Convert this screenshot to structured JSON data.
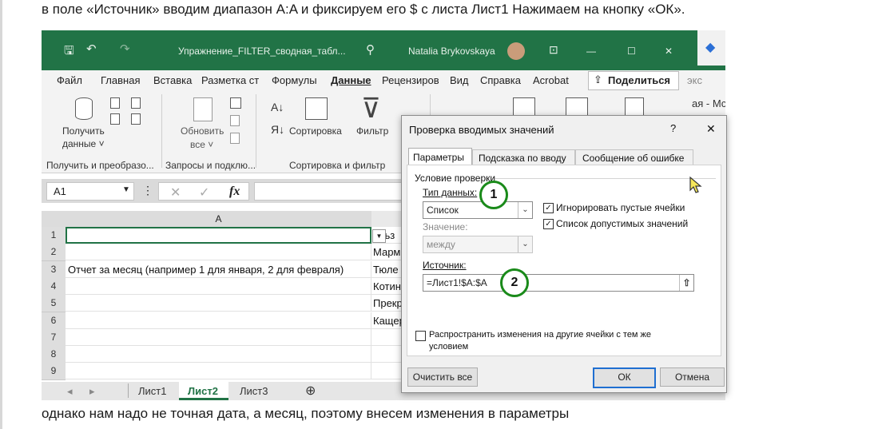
{
  "doc": {
    "top_text": "в поле «Источник» вводим диапазон A:A и фиксируем его $ с листа Лист1  Нажимаем на кнопку «ОК».",
    "bottom_text": "однако нам надо не точная дата, а месяц, поэтому внесем изменения в параметры"
  },
  "excel": {
    "file_title": "Упражнение_FILTER_сводная_табл...",
    "search_icon": "search-icon",
    "user_name": "Natalia Brykovskaya",
    "menu": [
      "Файл",
      "Главная",
      "Вставка",
      "Разметка ст",
      "Формулы",
      "Данные",
      "Рецензиров",
      "Вид",
      "Справка",
      "Acrobat"
    ],
    "active_menu": "Данные",
    "share_label": "Поделиться",
    "ribbon": {
      "get_data": "Получить",
      "get_data_2": "данные ˅",
      "refresh": "Обновить",
      "refresh_2": "все ˅",
      "sort": "Сортировка",
      "filter": "Фильтр",
      "group1": "Получить и преобразо...",
      "group2": "Запросы и подклю...",
      "group3": "Сортировка и фильтр"
    },
    "name_box": "A1",
    "fx": "fx",
    "col_a": "A",
    "rows": [
      {
        "n": "1",
        "a": "",
        "b": "ольз"
      },
      {
        "n": "2",
        "a": "",
        "b": "Марм"
      },
      {
        "n": "3",
        "a": "Отчет за месяц (например 1 для января, 2 для февраля)",
        "b": "Тюле"
      },
      {
        "n": "4",
        "a": "",
        "b": "Котин"
      },
      {
        "n": "5",
        "a": "",
        "b": "Прекр"
      },
      {
        "n": "6",
        "a": "",
        "b": "Кащер"
      },
      {
        "n": "7",
        "a": "",
        "b": ""
      },
      {
        "n": "8",
        "a": "",
        "b": ""
      },
      {
        "n": "9",
        "a": "",
        "b": ""
      }
    ],
    "sheets": [
      "Лист1",
      "Лист2",
      "Лист3"
    ],
    "active_sheet": "Лист2",
    "behind_text_1": "экс",
    "behind_text_2": "ая - Мс"
  },
  "dialog": {
    "title": "Проверка вводимых значений",
    "help": "?",
    "close": "✕",
    "tabs": [
      "Параметры",
      "Подсказка по вводу",
      "Сообщение об ошибке"
    ],
    "section": "Условие проверки",
    "data_type_label": "Тип данных:",
    "data_type_value": "Список",
    "ignore_blank": "Игнорировать пустые ячейки",
    "in_cell_dropdown": "Список допустимых значений",
    "value_label": "Значение:",
    "value_value": "между",
    "source_label": "Источник:",
    "source_value": "=Лист1!$A:$A",
    "apply_all": "Распространить изменения на другие ячейки с тем же",
    "apply_all_2": "условием",
    "clear_all": "Очистить все",
    "ok": "ОК",
    "cancel": "Отмена"
  },
  "annotations": [
    "1",
    "2"
  ]
}
